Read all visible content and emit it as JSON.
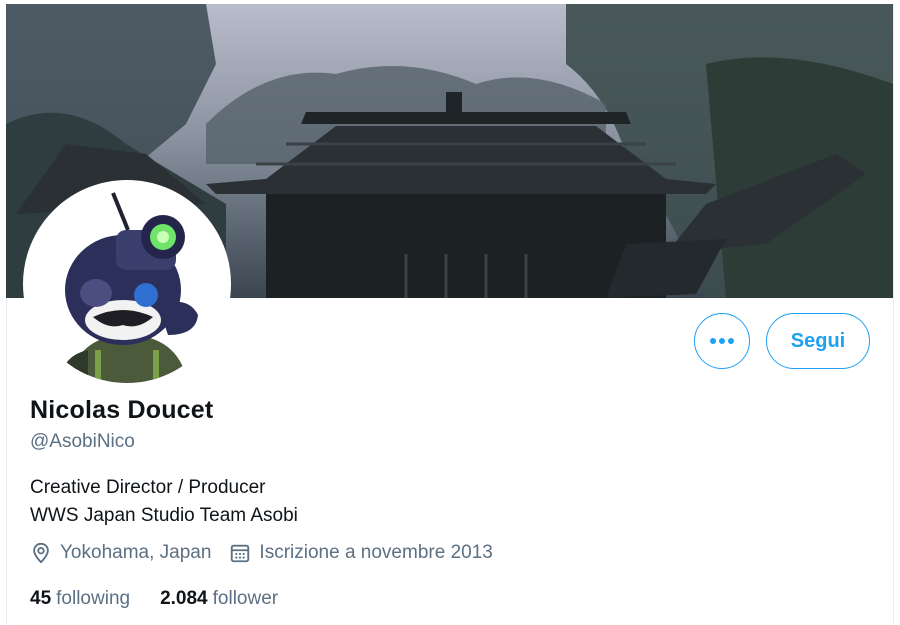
{
  "profile": {
    "name": "Nicolas Doucet",
    "handle": "@AsobiNico",
    "bio_line1": "Creative Director / Producer",
    "bio_line2": "WWS Japan Studio Team Asobi",
    "location": "Yokohama, Japan",
    "joined": "Iscrizione a novembre 2013"
  },
  "actions": {
    "more_label": "•••",
    "follow_label": "Segui"
  },
  "stats": {
    "following_count": "45",
    "following_label": "following",
    "followers_count": "2.084",
    "followers_label": "follower"
  },
  "icons": {
    "location": "location-pin-icon",
    "calendar": "calendar-icon",
    "more": "more-dots-icon"
  },
  "colors": {
    "accent": "#1da1f2",
    "secondary_text": "#5b7083",
    "primary_text": "#0f1419"
  }
}
